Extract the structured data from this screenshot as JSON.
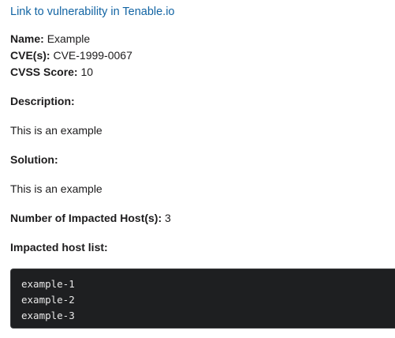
{
  "link": {
    "text": "Link to vulnerability in Tenable.io"
  },
  "meta": {
    "name_label": "Name:",
    "name_value": "Example",
    "cve_label": "CVE(s):",
    "cve_value": "CVE-1999-0067",
    "cvss_label": "CVSS Score:",
    "cvss_value": "10"
  },
  "description": {
    "title": "Description:",
    "text": "This is an example"
  },
  "solution": {
    "title": "Solution:",
    "text": "This is an example"
  },
  "impacted": {
    "count_label": "Number of Impacted Host(s):",
    "count_value": "3",
    "list_title": "Impacted host list:",
    "hosts": [
      "example-1",
      "example-2",
      "example-3"
    ]
  }
}
